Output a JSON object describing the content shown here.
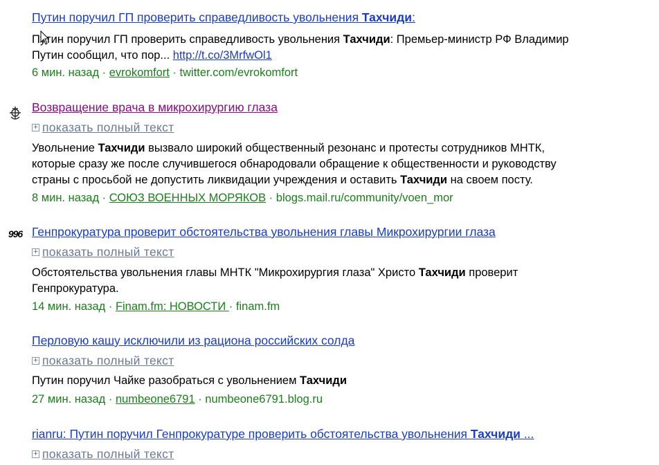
{
  "results": [
    {
      "title": {
        "pre": "Путин поручил ГП проверить справедливость увольнения ",
        "bold": "Тахчиди",
        "post": ":"
      },
      "snippet": {
        "line1_pre": "Путин поручил ГП проверить справедливость увольнения ",
        "line1_bold": "Тахчиди",
        "line1_post": ": Премьер-министр РФ Владимир",
        "line2_pre": "Путин сообщил, что пор... ",
        "link": "http://t.co/3MrfwOl1"
      },
      "meta": {
        "time": "6 мин. назад",
        "sep": " · ",
        "author": "evrokomfort",
        "sep2": " · ",
        "site": "twitter.com/evrokomfort"
      }
    },
    {
      "title": {
        "text": "Возвращение врача в микрохирургию глаза"
      },
      "expand": "показать полный текст",
      "snippet": {
        "l1a": "Увольнение ",
        "l1b": "Тахчиди",
        "l1c": " вызвало широкий общественный резонанс и протесты сотрудников МНТК,",
        "l2": "которые сразу же после случившегося обнародовали обращение к общественности и руководству",
        "l3a": "страны с просьбой не допустить ликвидации учреждения и оставить ",
        "l3b": "Тахчиди",
        "l3c": " на своем посту."
      },
      "meta": {
        "time": "8 мин. назад",
        "sep": " · ",
        "author": "СОЮЗ ВОЕННЫХ МОРЯКОВ",
        "sep2": " · ",
        "site": "blogs.mail.ru/community/voen_mor"
      }
    },
    {
      "title": {
        "text": "Генпрокуратура проверит обстоятельства увольнения главы Микрохирургии глаза"
      },
      "icon_text": "996",
      "expand": "показать полный текст",
      "snippet": {
        "l1a": "Обстоятельства увольнения главы МНТК \"Микрохирургия глаза\" Христо ",
        "l1b": "Тахчиди",
        "l1c": " проверит",
        "l2": "Генпрокуратура."
      },
      "meta": {
        "time": "14 мин. назад",
        "sep": " · ",
        "author": "Finam.fm: НОВОСТИ ",
        "sep2": " · ",
        "site": "finam.fm"
      }
    },
    {
      "title": {
        "text": "Перловую кашу исключили из рациона российских солда"
      },
      "expand": "показать полный текст",
      "snippet": {
        "l1a": "Путин поручил Чайке разобраться с увольнением ",
        "l1b": "Тахчиди"
      },
      "meta": {
        "time": "27 мин. назад",
        "sep": " · ",
        "author": "numbeone6791",
        "sep2": " · ",
        "site": "numbeone6791.blog.ru"
      }
    },
    {
      "title": {
        "pre": "rianru: Путин поручил Генпрокуратуре проверить обстоятельства увольнения ",
        "bold": "Тахчиди",
        "post": " ..."
      },
      "expand": "показать полный текст"
    }
  ],
  "colors": {
    "link": "#1a3dc1",
    "visited": "#8b0a83",
    "meta": "#1b7d1b",
    "expand": "#6a7a93"
  },
  "icons": {
    "mouse": "mouse-pointer-icon",
    "emblem": "navy-emblem-icon",
    "finam": "finam-logo-icon",
    "expand": "plus-box-icon"
  }
}
